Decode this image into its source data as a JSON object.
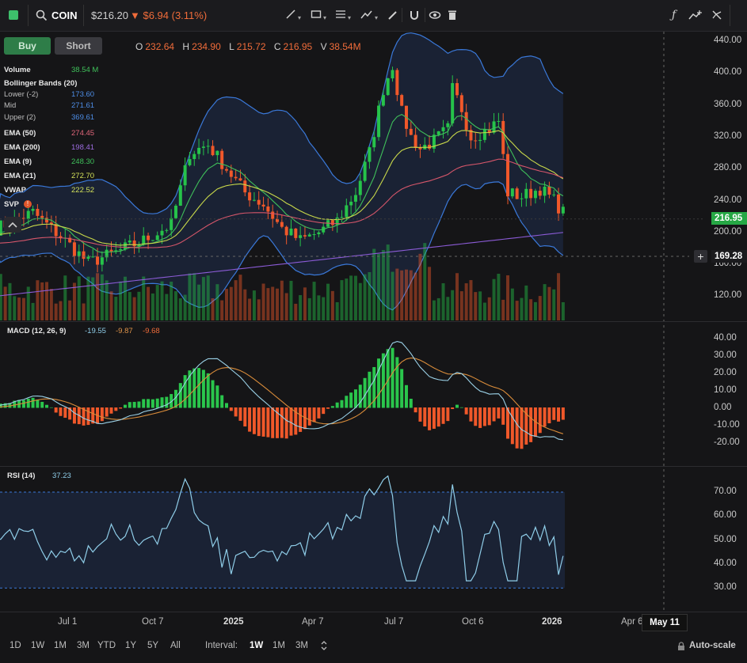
{
  "header": {
    "symbol": "COIN",
    "price": "$216.20",
    "change": "▼ $6.94 (3.11%)"
  },
  "trade": {
    "buy_label": "Buy",
    "short_label": "Short"
  },
  "ohlc": {
    "o_label": "O",
    "o": "232.64",
    "h_label": "H",
    "h": "234.90",
    "l_label": "L",
    "l": "215.72",
    "c_label": "C",
    "c": "216.95",
    "v_label": "V",
    "v": "38.54M"
  },
  "legend": {
    "volume_label": "Volume",
    "volume_value": "38.54 M",
    "bb_label": "Bollinger Bands (20)",
    "bb_lower_label": "Lower (-2)",
    "bb_lower": "173.60",
    "bb_mid_label": "Mid",
    "bb_mid": "271.61",
    "bb_upper_label": "Upper (2)",
    "bb_upper": "369.61",
    "ema50_label": "EMA (50)",
    "ema50": "274.45",
    "ema200_label": "EMA (200)",
    "ema200": "198.41",
    "ema9_label": "EMA (9)",
    "ema9": "248.30",
    "ema21_label": "EMA (21)",
    "ema21": "272.70",
    "vwap_label": "VWAP",
    "vwap": "222.52",
    "svp_label": "SVP"
  },
  "colors": {
    "up": "#26c34a",
    "down": "#f0582a",
    "bb": "#3a78d8",
    "ema50": "#d6566a",
    "ema200": "#8b5bd6",
    "ema9": "#3fc05a",
    "ema21": "#c8d84a",
    "macd": "#9ad0e6",
    "signal": "#d98c3a",
    "rsi": "#8fcde8"
  },
  "price_axis": [
    "440.00",
    "400.00",
    "360.00",
    "320.00",
    "280.00",
    "240.00",
    "200.00",
    "160.00",
    "120.00"
  ],
  "price_tag": "216.95",
  "crosshair_tag": "169.28",
  "macd": {
    "label": "MACD (12, 26, 9)",
    "v1": "-19.55",
    "v2": "-9.87",
    "v3": "-9.68",
    "axis": [
      "40.00",
      "30.00",
      "20.00",
      "10.00",
      "0.00",
      "-10.00",
      "-20.00"
    ]
  },
  "rsi": {
    "label": "RSI (14)",
    "value": "37.23",
    "axis": [
      "70.00",
      "60.00",
      "50.00",
      "40.00",
      "30.00"
    ]
  },
  "time_axis": [
    "Jul 1",
    "Oct 7",
    "2025",
    "Apr 7",
    "Jul 7",
    "Oct 6",
    "2026",
    "Apr 6"
  ],
  "crosshair_date": "May 11",
  "ranges": [
    "1D",
    "1W",
    "1M",
    "3M",
    "YTD",
    "1Y",
    "5Y",
    "All"
  ],
  "interval_label": "Interval:",
  "intervals": [
    "1W",
    "1M",
    "3M"
  ],
  "active_interval": "1W",
  "autoscale_label": "Auto-scale"
}
